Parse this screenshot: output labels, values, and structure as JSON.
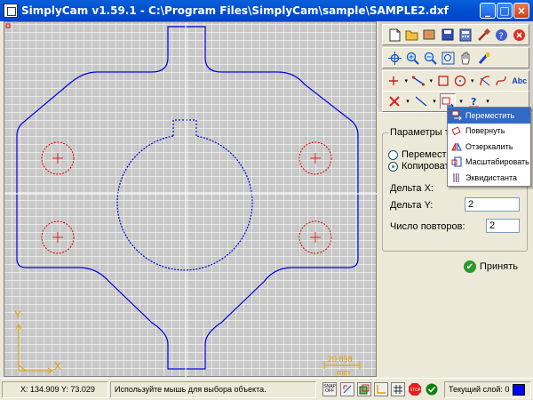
{
  "window": {
    "title": "SimplyCam v1.59.1 - C:\\Program Files\\SimplyCam\\sample\\SAMPLE2.dxf",
    "minimize": "_",
    "maximize": "□",
    "close": "×"
  },
  "canvas": {
    "axis_y": "Y",
    "axis_x": "X",
    "scale_value": "20.898",
    "scale_unit": "mm",
    "colors": {
      "part": "#0000e0",
      "holes": "#e00000",
      "crosshair": "#ffffff",
      "axis": "#e4a000"
    }
  },
  "toolbar": {
    "row1": [
      "new-icon",
      "open-icon",
      "import-icon",
      "save-icon",
      "calc-icon",
      "tool-icon",
      "help-icon",
      "exit-icon"
    ],
    "row2": [
      "select-icon",
      "zoom-in-icon",
      "zoom-out-icon",
      "zoom-window-icon",
      "pan-icon",
      "brush-icon"
    ],
    "row3": [
      "point-icon",
      "line-icon",
      "rect-icon",
      "circle-icon",
      "arc-icon",
      "curve-icon",
      "text-icon"
    ],
    "row3_text": "Abc",
    "row4": [
      "delete-icon",
      "trim-icon",
      "transform-icon",
      "info-icon"
    ]
  },
  "params": {
    "group_title": "Параметры тран",
    "radio_move": "Переместить",
    "radio_copy": "Копировать",
    "delta_x_label": "Дельта X:",
    "delta_y_label": "Дельта Y:",
    "delta_y_value": "2",
    "repeats_label": "Число повторов:",
    "repeats_value": "2",
    "apply_label": "Принять"
  },
  "menu": {
    "items": [
      {
        "label": "Переместить",
        "icon": "move-icon"
      },
      {
        "label": "Повернуть",
        "icon": "rotate-icon"
      },
      {
        "label": "Отзеркалить",
        "icon": "mirror-icon"
      },
      {
        "label": "Масштабировать",
        "icon": "scale-icon"
      },
      {
        "label": "Эквидистанта",
        "icon": "offset-icon"
      }
    ]
  },
  "status": {
    "coords": "X: 134.909 Y: 73.029",
    "hint": "Используйте мышь для выбора объекта.",
    "snap": "SNAP OFF",
    "layer_label": "Текущий слой: 0"
  }
}
